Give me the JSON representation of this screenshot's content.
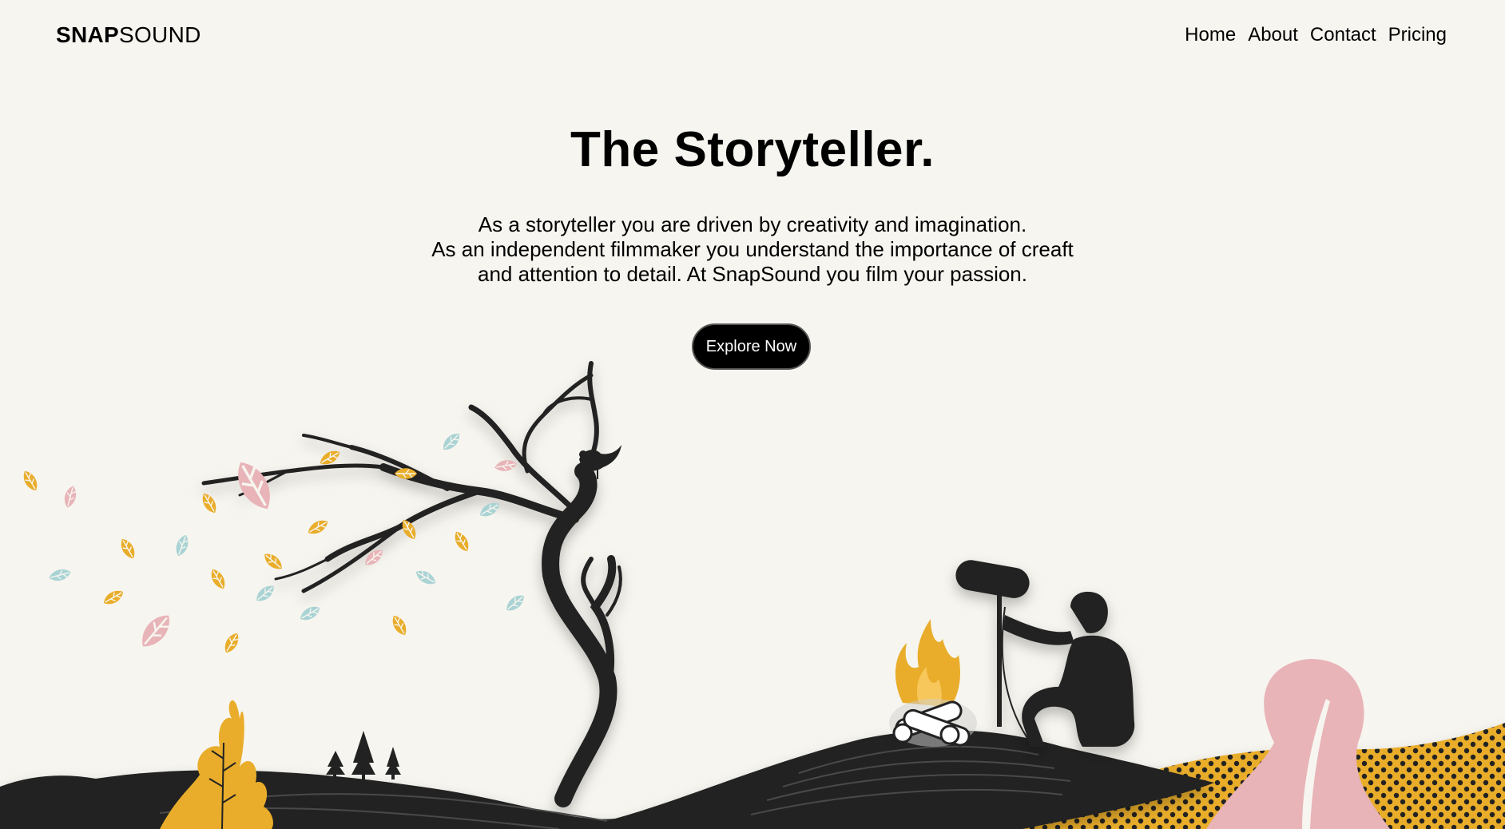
{
  "brand": {
    "bold": "SNAP",
    "light": "SOUND"
  },
  "nav": {
    "home": "Home",
    "about": "About",
    "contact": "Contact",
    "pricing": "Pricing"
  },
  "hero": {
    "title": "The Storyteller.",
    "lines": [
      "As a storyteller you are driven by creativity and imagination.",
      "As an independent filmmaker you understand the importance of creaft",
      "and attention to detail. At SnapSound you film your passion."
    ],
    "cta": "Explore Now"
  },
  "colors": {
    "background": "#f7f5ef",
    "ink": "#222222",
    "mustard": "#e9ad2b",
    "pink": "#e8b4b8",
    "teal": "#a9d3d4"
  },
  "illustration": {
    "elements": [
      "windswept-tree",
      "bird",
      "falling-leaves",
      "pine-trees",
      "campfire",
      "sound-recordist",
      "boom-microphone",
      "rolling-hills",
      "mustard-plant",
      "pink-plant",
      "polka-dot-field"
    ]
  }
}
